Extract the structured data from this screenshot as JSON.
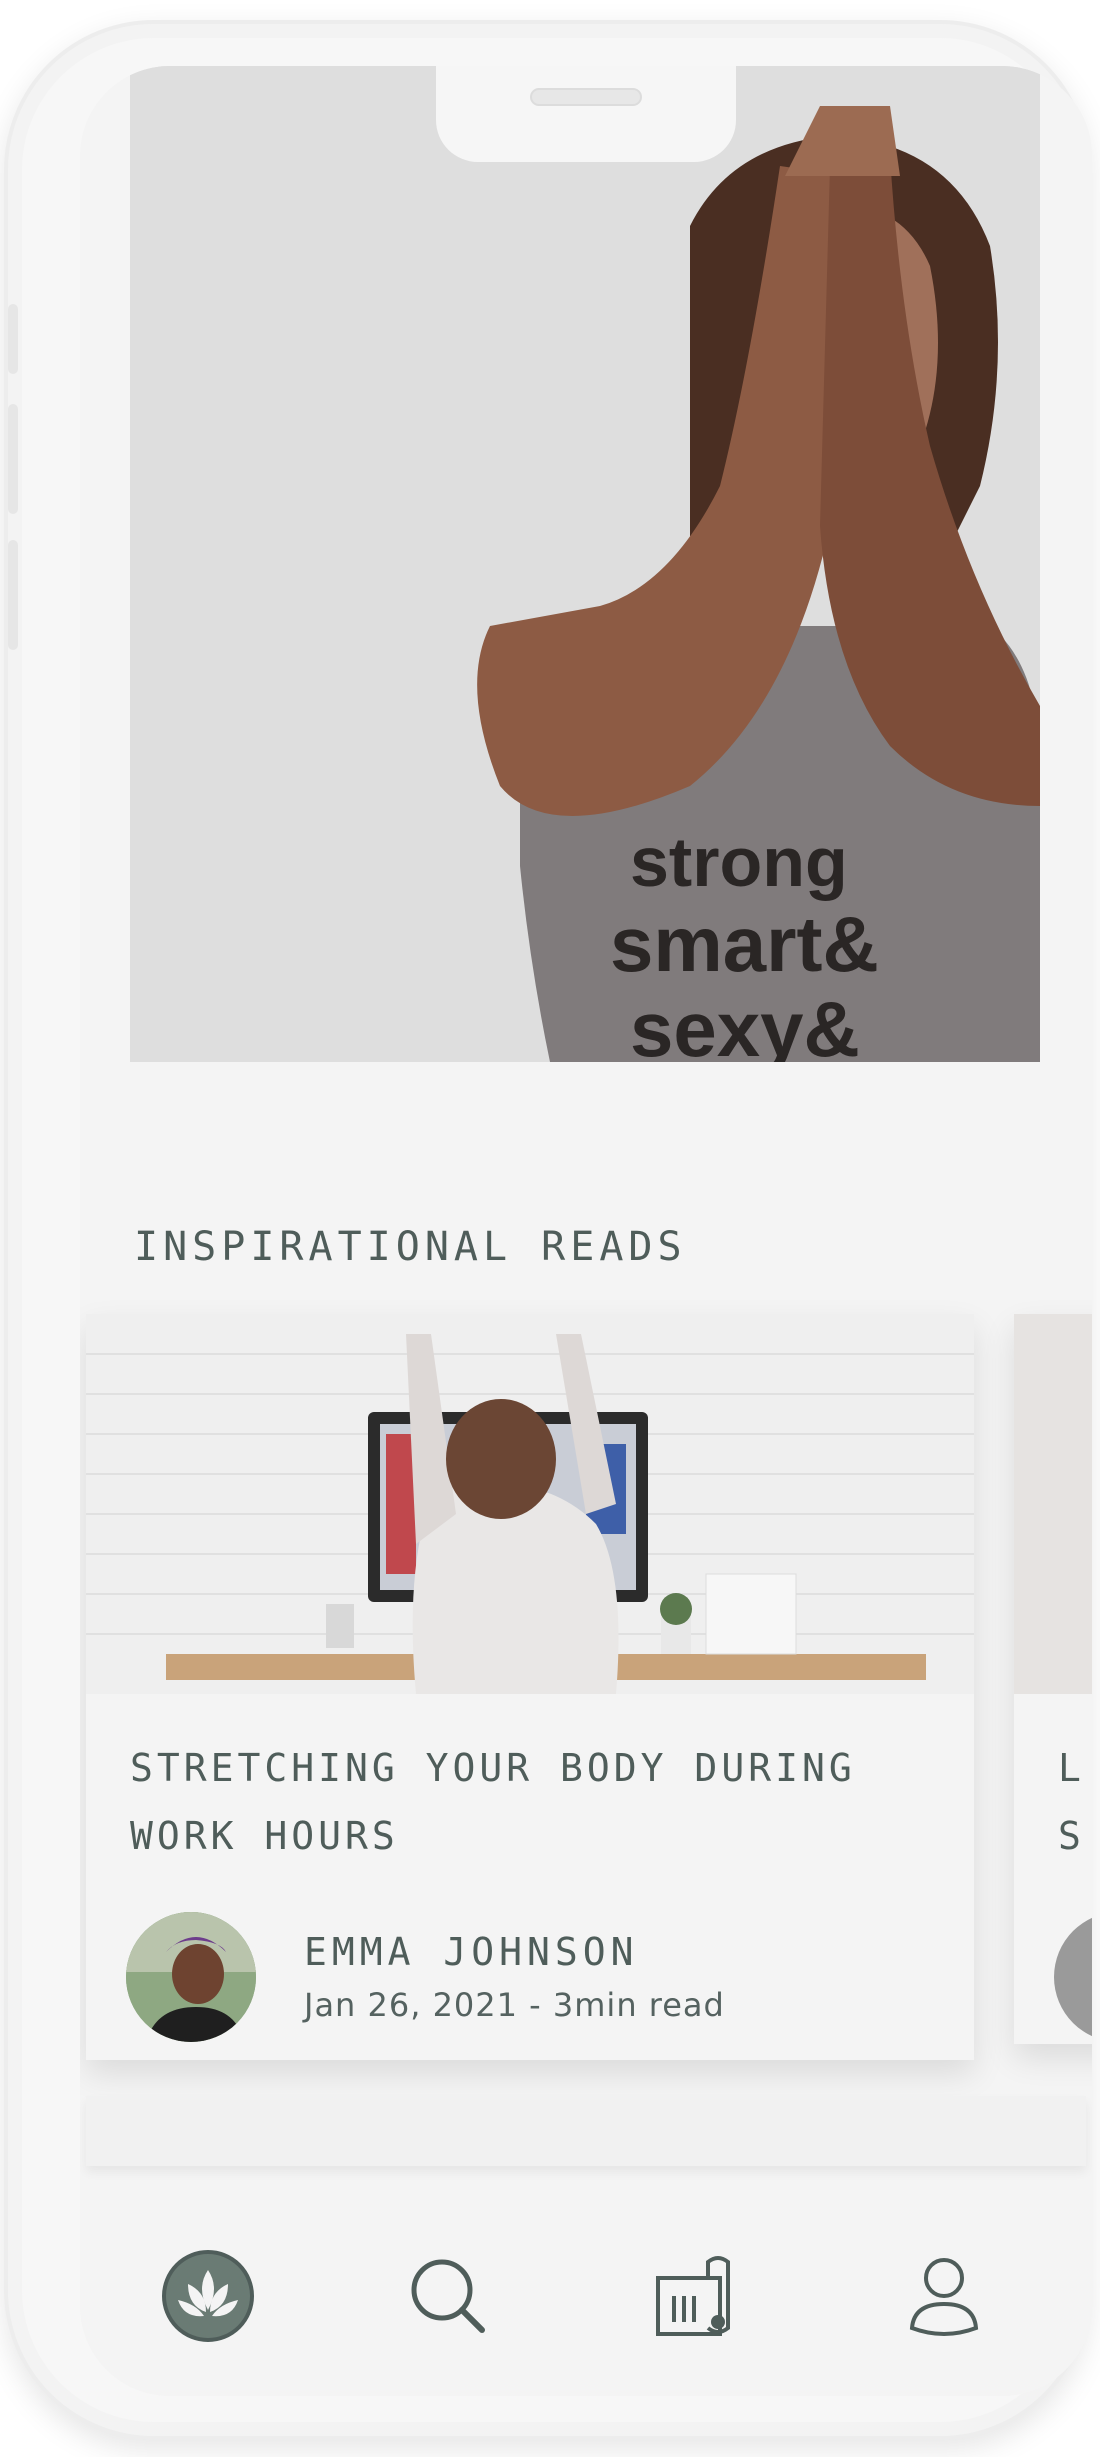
{
  "section": {
    "title": "INSPIRATIONAL READS"
  },
  "hero": {
    "shirt_text_line1": "strong",
    "shirt_text_line2": "smart&",
    "shirt_text_line3": "sexy&"
  },
  "articles": [
    {
      "title": "STRETCHING YOUR BODY DURING WORK HOURS",
      "author": "EMMA JOHNSON",
      "meta": "Jan 26, 2021 - 3min read"
    },
    {
      "title_peek_line1": "L",
      "title_peek_line2": "S"
    }
  ],
  "tabbar": {
    "items": [
      {
        "icon": "lotus-icon",
        "active": true
      },
      {
        "icon": "search-icon",
        "active": false
      },
      {
        "icon": "yoga-mat-icon",
        "active": false
      },
      {
        "icon": "profile-icon",
        "active": false
      }
    ]
  },
  "colors": {
    "accent": "#4f5d5a",
    "background": "#f4f4f4"
  }
}
